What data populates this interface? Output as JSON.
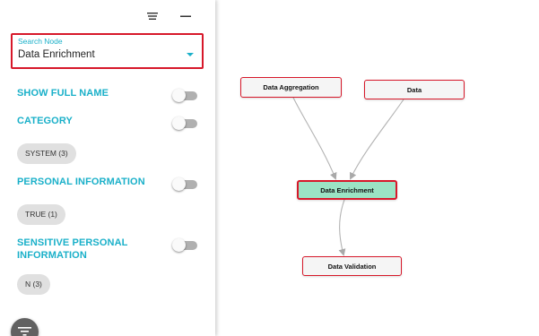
{
  "search": {
    "label": "Search Node",
    "value": "Data Enrichment"
  },
  "filters": {
    "show_full_name": {
      "title": "SHOW FULL NAME",
      "enabled": false
    },
    "category": {
      "title": "CATEGORY",
      "enabled": false,
      "chip": "SYSTEM (3)"
    },
    "personal_information": {
      "title": "PERSONAL INFORMATION",
      "enabled": false,
      "chip": "TRUE (1)"
    },
    "sensitive_personal_information": {
      "title_line1": "SENSITIVE PERSONAL",
      "title_line2": "INFORMATION",
      "enabled": false,
      "chip": "N (3)"
    }
  },
  "graph": {
    "nodes": [
      {
        "id": "aggregation",
        "label": "Data Aggregation",
        "selected": false
      },
      {
        "id": "data",
        "label": "Data",
        "selected": false
      },
      {
        "id": "enrichment",
        "label": "Data Enrichment",
        "selected": true
      },
      {
        "id": "validation",
        "label": "Data Validation",
        "selected": false
      }
    ],
    "edges": [
      {
        "from": "aggregation",
        "to": "enrichment"
      },
      {
        "from": "data",
        "to": "enrichment"
      },
      {
        "from": "enrichment",
        "to": "validation"
      }
    ]
  },
  "colors": {
    "accent": "#1ab0c9",
    "highlight_border": "#d7182a",
    "selected_node": "#9be3c4"
  },
  "icons": {
    "menu": "menu-lines-icon",
    "minimize": "minimize-icon",
    "dropdown": "caret-down-icon",
    "filter": "filter-list-icon"
  }
}
